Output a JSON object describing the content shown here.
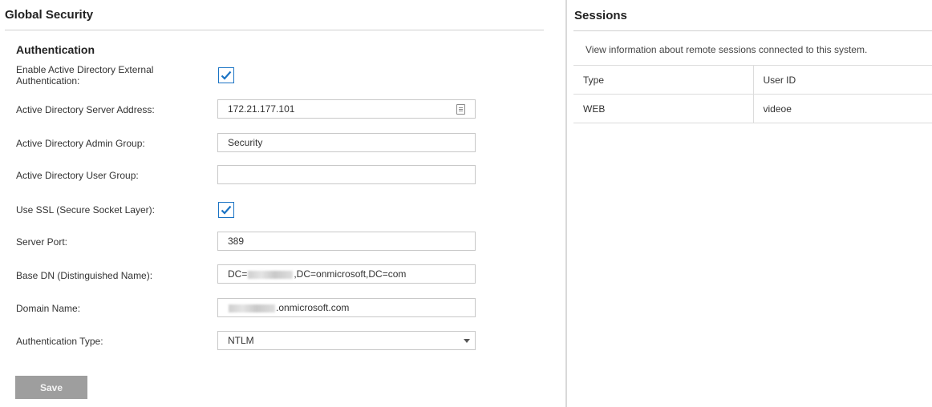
{
  "global_security": {
    "title": "Global Security",
    "section_title": "Authentication",
    "fields": {
      "enable_ad": {
        "label": "Enable Active Directory External Authentication:",
        "checked": true
      },
      "server_address": {
        "label": "Active Directory Server Address:",
        "value": "172.21.177.101"
      },
      "admin_group": {
        "label": "Active Directory Admin Group:",
        "value": "Security"
      },
      "user_group": {
        "label": "Active Directory User Group:",
        "value": ""
      },
      "use_ssl": {
        "label": "Use SSL (Secure Socket Layer):",
        "checked": true
      },
      "server_port": {
        "label": "Server Port:",
        "value": "389"
      },
      "base_dn": {
        "label": "Base DN (Distinguished Name):",
        "value_prefix": "DC=",
        "value_suffix": ",DC=onmicrosoft,DC=com"
      },
      "domain_name": {
        "label": "Domain Name:",
        "value_suffix": ".onmicrosoft.com"
      },
      "auth_type": {
        "label": "Authentication Type:",
        "value": "NTLM"
      }
    },
    "save_label": "Save"
  },
  "sessions": {
    "title": "Sessions",
    "description": "View information about remote sessions connected to this system.",
    "columns": [
      "Type",
      "User ID"
    ],
    "rows": [
      {
        "type": "WEB",
        "user_id": "videoe"
      }
    ]
  },
  "colors": {
    "accent": "#1a73c4",
    "button_disabled": "#9e9e9e"
  },
  "icons": {
    "address_field": "contact-card-icon",
    "checkbox": "checkmark-icon",
    "select": "caret-down-icon"
  }
}
